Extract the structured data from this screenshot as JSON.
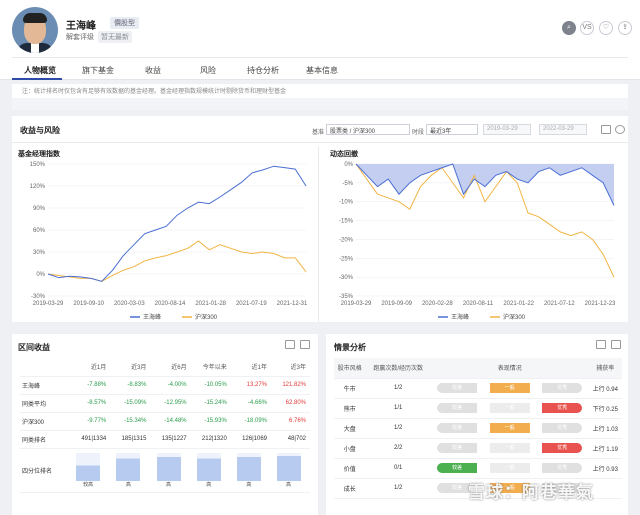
{
  "header": {
    "name": "王海峰",
    "style_badge": "價股型",
    "rating_label": "解套评级",
    "rating_value": "暂无最新"
  },
  "tabs": [
    "人物概览",
    "旗下基金",
    "收益",
    "风险",
    "持仓分析",
    "基本信息"
  ],
  "note": "注：统计排名时仅包含有足够有效数据的基金经理。基金经理指数规模统计时剔除货币和理财型基金",
  "perf": {
    "title": "收益与风险",
    "bench_label": "基准",
    "bench_value": "股票类 / 沪深300",
    "period_label": "时段",
    "period_value": "最近3年",
    "date_from": "2019-03-29",
    "date_to": "2022-03-29"
  },
  "charts": {
    "index": {
      "title": "基金经理指数",
      "legend": [
        "王海峰",
        "沪深300"
      ]
    },
    "dd": {
      "title": "动态回撤",
      "legend": [
        "王海峰",
        "沪深300"
      ]
    }
  },
  "chart_data": [
    {
      "type": "line",
      "title": "基金经理指数",
      "x": [
        "2019-03-29",
        "2019-09-10",
        "2020-03-03",
        "2020-08-14",
        "2021-01-28",
        "2021-07-19",
        "2021-12-31"
      ],
      "ylim": [
        -30,
        150
      ],
      "yticks": [
        "150%",
        "120%",
        "90%",
        "60%",
        "30%",
        "0%",
        "-30%"
      ],
      "series": [
        {
          "name": "王海峰",
          "color": "#4a6fd4",
          "values": [
            0,
            -5,
            -3,
            -4,
            -6,
            -10,
            5,
            25,
            40,
            55,
            60,
            65,
            80,
            90,
            98,
            96,
            105,
            115,
            125,
            138,
            142,
            147,
            145,
            143,
            120
          ]
        },
        {
          "name": "沪深300",
          "color": "#f2b444",
          "values": [
            0,
            -2,
            -4,
            -6,
            -6,
            -10,
            -2,
            5,
            10,
            18,
            22,
            25,
            30,
            35,
            45,
            33,
            40,
            35,
            30,
            28,
            30,
            28,
            22,
            22,
            3
          ]
        }
      ]
    },
    {
      "type": "area",
      "title": "动态回撤",
      "x": [
        "2019-03-29",
        "2019-09-09",
        "2020-02-28",
        "2020-08-11",
        "2021-01-22",
        "2021-07-12",
        "2021-12-23"
      ],
      "ylim": [
        -35,
        0
      ],
      "yticks": [
        "0%",
        "-5%",
        "-10%",
        "-15%",
        "-20%",
        "-25%",
        "-30%",
        "-35%"
      ],
      "series": [
        {
          "name": "王海峰",
          "color": "#4a6fd4",
          "values": [
            0,
            -3,
            -6,
            -4,
            -8,
            -5,
            -3,
            -2,
            -1,
            0,
            -8,
            -4,
            -6,
            -3,
            -2,
            -4,
            -5,
            -2,
            -1,
            -3,
            -2,
            -1,
            -3,
            -5,
            -11
          ]
        },
        {
          "name": "沪深300",
          "color": "#f2b444",
          "values": [
            0,
            -4,
            -8,
            -9,
            -10,
            -12,
            -6,
            -3,
            -1,
            -5,
            -9,
            -3,
            -10,
            -6,
            -2,
            -5,
            -13,
            -14,
            -16,
            -18,
            -19,
            -18,
            -20,
            -24,
            -30
          ]
        }
      ]
    }
  ],
  "interval": {
    "title": "区间收益",
    "headers": [
      "",
      "近1月",
      "近3月",
      "近6月",
      "今年以来",
      "近1年",
      "近3年"
    ],
    "rows": [
      {
        "label": "王海峰",
        "cells": [
          "-7.88%",
          "-8.83%",
          "-4.00%",
          "-10.05%",
          "13.27%",
          "121.82%"
        ],
        "signs": [
          "n",
          "n",
          "n",
          "n",
          "p",
          "p"
        ]
      },
      {
        "label": "同类平均",
        "cells": [
          "-8.57%",
          "-15.09%",
          "-12.95%",
          "-15.24%",
          "-4.66%",
          "62.80%"
        ],
        "signs": [
          "n",
          "n",
          "n",
          "n",
          "n",
          "p"
        ]
      },
      {
        "label": "沪深300",
        "cells": [
          "-9.77%",
          "-15.34%",
          "-14.48%",
          "-15.93%",
          "-18.09%",
          "6.76%"
        ],
        "signs": [
          "n",
          "n",
          "n",
          "n",
          "n",
          "p"
        ]
      },
      {
        "label": "同类排名",
        "cells": [
          "491|1334",
          "185|1315",
          "135|1227",
          "212|1320",
          "126|1069",
          "48|702"
        ],
        "signs": [
          "x",
          "x",
          "x",
          "x",
          "x",
          "x"
        ]
      }
    ],
    "quartile_label": "四分位排名",
    "quartile_values": [
      "较高",
      "高",
      "高",
      "高",
      "高",
      "高"
    ],
    "quartile_levels": [
      0.55,
      0.8,
      0.85,
      0.8,
      0.85,
      0.9
    ]
  },
  "situation": {
    "title": "情景分析",
    "headers": [
      "股市风格",
      "跑赢次数/经历次数",
      "表现情况",
      "",
      "",
      "捕获率"
    ],
    "rows": [
      {
        "label": "牛市",
        "count": "1/2",
        "perf": "m",
        "rate": "上行 0.94"
      },
      {
        "label": "熊市",
        "count": "1/1",
        "perf": "y",
        "rate": "下行 0.25"
      },
      {
        "label": "大盘",
        "count": "1/2",
        "perf": "m",
        "rate": "上行 1.03"
      },
      {
        "label": "小盘",
        "count": "2/2",
        "perf": "y",
        "rate": "上行 1.19"
      },
      {
        "label": "价值",
        "count": "0/1",
        "perf": "g",
        "rate": "上行 0.93"
      },
      {
        "label": "成长",
        "count": "1/2",
        "perf": "m",
        "rate": ""
      }
    ],
    "pill_labels": [
      "较差",
      "一般",
      "优秀"
    ]
  },
  "watermark": "雪球：阿巷華氣"
}
